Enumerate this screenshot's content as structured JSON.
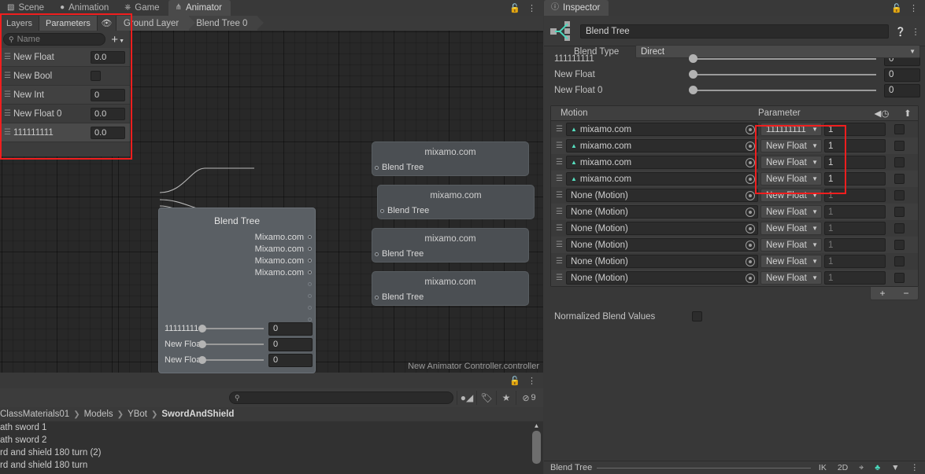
{
  "window_tabs": [
    {
      "label": "Scene",
      "icon": "grid-icon",
      "active": false
    },
    {
      "label": "Animation",
      "icon": "clock-icon",
      "active": false
    },
    {
      "label": "Game",
      "icon": "gamepad-icon",
      "active": false
    },
    {
      "label": "Animator",
      "icon": "animator-icon",
      "active": true
    }
  ],
  "window_buttons": {
    "lock": "lock-icon",
    "menu": "kebab-menu-icon"
  },
  "animator": {
    "toolbar": {
      "layers_tab": "Layers",
      "parameters_tab": "Parameters",
      "eye_icon": "eye-icon",
      "breadcrumbs": [
        "Ground Layer",
        "Blend Tree 0"
      ]
    },
    "parameters_panel": {
      "search_placeholder": "Name",
      "search_icon": "search-icon",
      "add_label": "+",
      "rows": [
        {
          "name": "New Float",
          "type": "float",
          "value": "0.0"
        },
        {
          "name": "New Bool",
          "type": "bool",
          "value": ""
        },
        {
          "name": "New Int",
          "type": "int",
          "value": "0"
        },
        {
          "name": "New Float 0",
          "type": "float",
          "value": "0.0"
        },
        {
          "name": "111111111",
          "type": "float",
          "value": "0.0"
        }
      ]
    },
    "blend_tree_node": {
      "title": "Blend Tree",
      "outputs": [
        "Mixamo.com",
        "Mixamo.com",
        "Mixamo.com",
        "Mixamo.com"
      ],
      "empty_output_count": 6,
      "sliders": [
        {
          "label": "11111111",
          "value": "0"
        },
        {
          "label": "New Floa",
          "value": "0"
        },
        {
          "label": "New Floa",
          "value": "0"
        }
      ]
    },
    "motion_nodes": [
      {
        "title": "mixamo.com",
        "subtitle": "Blend Tree"
      },
      {
        "title": "mixamo.com",
        "subtitle": "Blend Tree"
      },
      {
        "title": "mixamo.com",
        "subtitle": "Blend Tree"
      },
      {
        "title": "mixamo.com",
        "subtitle": "Blend Tree"
      }
    ],
    "footer": "New Animator Controller.controller"
  },
  "project": {
    "toolbar": {
      "search_placeholder": "",
      "search_icon": "search-icon",
      "icons": [
        "asset-filter-icon",
        "label-filter-icon",
        "favorite-star-icon",
        "hidden-toggle-icon"
      ],
      "hidden_count": "9"
    },
    "breadcrumb": [
      "ClassMaterials01",
      "Models",
      "YBot",
      "SwordAndShield"
    ],
    "items": [
      "ath sword 1",
      "ath sword 2",
      "rd and shield 180 turn (2)",
      "rd and shield 180 turn"
    ]
  },
  "inspector": {
    "tab_label": "Inspector",
    "tab_icon": "info-icon",
    "lock_icon": "lock-icon",
    "menu_icon": "kebab-menu-icon",
    "object_icon": "blend-tree-icon",
    "name": "Blend Tree",
    "help_icon": "help-icon",
    "preset_icon": "kebab-menu-icon",
    "blend_type_label": "Blend Type",
    "blend_type_value": "Direct",
    "parameter_sliders": [
      {
        "label": "111111111",
        "value": "0"
      },
      {
        "label": "New Float",
        "value": "0"
      },
      {
        "label": "New Float 0",
        "value": "0"
      }
    ],
    "motion_table": {
      "columns": {
        "motion": "Motion",
        "parameter": "Parameter",
        "timescale_icon": "time-scale-icon",
        "mirror_icon": "mirror-icon"
      },
      "rows": [
        {
          "motion": "mixamo.com",
          "has_clip": true,
          "parameter": "111111111",
          "value": "1",
          "mirror": false
        },
        {
          "motion": "mixamo.com",
          "has_clip": true,
          "parameter": "New Float",
          "value": "1",
          "mirror": false
        },
        {
          "motion": "mixamo.com",
          "has_clip": true,
          "parameter": "New Float",
          "value": "1",
          "mirror": false
        },
        {
          "motion": "mixamo.com",
          "has_clip": true,
          "parameter": "New Float",
          "value": "1",
          "mirror": false
        },
        {
          "motion": "None (Motion)",
          "has_clip": false,
          "parameter": "New Float",
          "value": "1",
          "mirror": false
        },
        {
          "motion": "None (Motion)",
          "has_clip": false,
          "parameter": "New Float",
          "value": "1",
          "mirror": false
        },
        {
          "motion": "None (Motion)",
          "has_clip": false,
          "parameter": "New Float",
          "value": "1",
          "mirror": false
        },
        {
          "motion": "None (Motion)",
          "has_clip": false,
          "parameter": "New Float",
          "value": "1",
          "mirror": false
        },
        {
          "motion": "None (Motion)",
          "has_clip": false,
          "parameter": "New Float",
          "value": "1",
          "mirror": false
        },
        {
          "motion": "None (Motion)",
          "has_clip": false,
          "parameter": "New Float",
          "value": "1",
          "mirror": false
        }
      ]
    },
    "add_label": "+",
    "remove_label": "−",
    "normalized_label": "Normalized Blend Values",
    "footer": {
      "name": "Blend Tree",
      "ik_label": "IK",
      "two_d_label": "2D",
      "pivot_icon": "pivot-icon",
      "avatar_icon": "avatar-icon",
      "menu_icon": "kebab-menu-icon"
    }
  },
  "annotation_color": "#f01e1e"
}
